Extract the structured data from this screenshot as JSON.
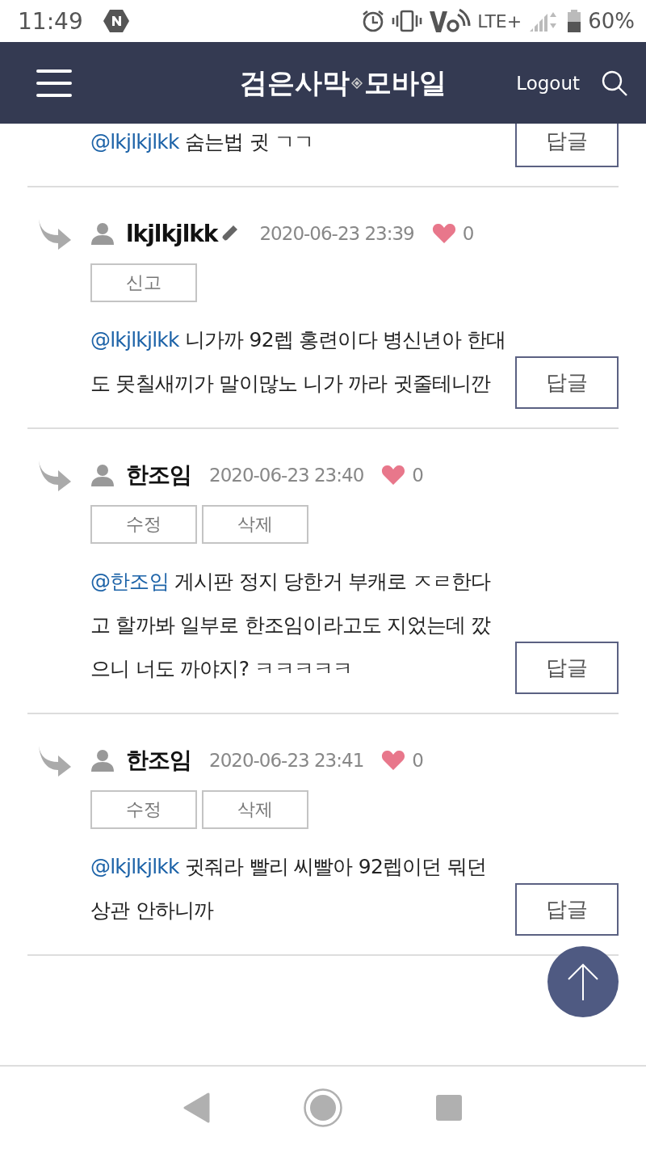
{
  "status_bar": {
    "time": "11:49",
    "network": "LTE+",
    "battery": "60%"
  },
  "header": {
    "logo_left": "검은사막",
    "logo_right": "모바일",
    "logout": "Logout"
  },
  "comments": [
    {
      "kind": "partial",
      "mention": "@lkjlkjlkk",
      "text": "숨는법 귓 ㄱㄱ",
      "reply": "답글"
    },
    {
      "kind": "full",
      "author": "lkjlkjlkk",
      "edit_icon": true,
      "date": "2020-06-23 23:39",
      "likes": "0",
      "actions": [
        "신고"
      ],
      "mention": "@lkjlkjlkk",
      "text": "니가까 92렙 홍련이다 병신년아 한대도 못칠새끼가 말이많노 니가 까라 귓줄테니깐",
      "reply": "답글"
    },
    {
      "kind": "full",
      "author": "한조임",
      "edit_icon": false,
      "date": "2020-06-23 23:40",
      "likes": "0",
      "actions": [
        "수정",
        "삭제"
      ],
      "mention": "@한조임",
      "text": "게시판 정지 당한거 부캐로 ㅈㄹ한다고 할까봐 일부로 한조임이라고도 지었는데 깠으니 너도 까야지? ㅋㅋㅋㅋㅋ",
      "reply": "답글"
    },
    {
      "kind": "full",
      "author": "한조임",
      "edit_icon": false,
      "date": "2020-06-23 23:41",
      "likes": "0",
      "actions": [
        "수정",
        "삭제"
      ],
      "mention": "@lkjlkjlkk",
      "text": "귓줘라 빨리 씨빨아 92렙이던 뭐던 상관 안하니까",
      "reply": "답글"
    }
  ]
}
